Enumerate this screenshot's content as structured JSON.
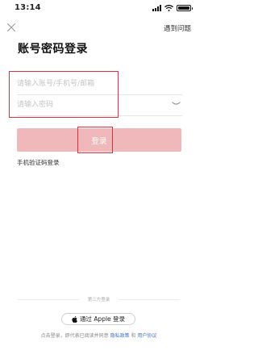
{
  "status_bar": {
    "time": "13:14"
  },
  "header": {
    "help_label": "遇到问题"
  },
  "page": {
    "title": "账号密码登录"
  },
  "form": {
    "account_placeholder": "请输入账号/手机号/邮箱",
    "password_placeholder": "请输入密码",
    "login_label": "登录",
    "sms_login_label": "手机验证码登录"
  },
  "third_party": {
    "divider_label": "第三方登录",
    "apple_login_label": "通过 Apple 登录"
  },
  "agreement": {
    "prefix": "点击登录，即代表已阅读并同意",
    "privacy_link": "隐私政策",
    "conjunction": "和",
    "user_agreement_link": "用户协议"
  },
  "colors": {
    "accent": "#f0b8ba",
    "highlight": "#e0303b",
    "link": "#3e6fd6"
  },
  "icons": [
    "signal-icon",
    "wifi-icon",
    "battery-icon",
    "close-icon",
    "eye-closed-icon",
    "apple-icon"
  ]
}
